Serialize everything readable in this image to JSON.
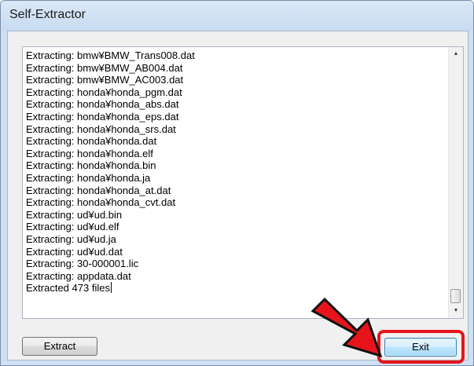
{
  "window": {
    "title": "Self-Extractor"
  },
  "log": {
    "lines": [
      "Extracting: bmw¥BMW_Trans008.dat",
      "Extracting: bmw¥BMW_AB004.dat",
      "Extracting: bmw¥BMW_AC003.dat",
      "Extracting: honda¥honda_pgm.dat",
      "Extracting: honda¥honda_abs.dat",
      "Extracting: honda¥honda_eps.dat",
      "Extracting: honda¥honda_srs.dat",
      "Extracting: honda¥honda.dat",
      "Extracting: honda¥honda.elf",
      "Extracting: honda¥honda.bin",
      "Extracting: honda¥honda.ja",
      "Extracting: honda¥honda_at.dat",
      "Extracting: honda¥honda_cvt.dat",
      "Extracting: ud¥ud.bin",
      "Extracting: ud¥ud.elf",
      "Extracting: ud¥ud.ja",
      "Extracting: ud¥ud.dat",
      "Extracting: 30-000001.lic",
      "Extracting: appdata.dat",
      "Extracted 473 files"
    ]
  },
  "scrollbar": {
    "up_icon": "triangle-up",
    "down_icon": "triangle-down"
  },
  "buttons": {
    "extract_label": "Extract",
    "exit_label": "Exit"
  },
  "annotation": {
    "color": "#e8141c",
    "arrow_icon": "red-arrow-pointing-down-right"
  }
}
